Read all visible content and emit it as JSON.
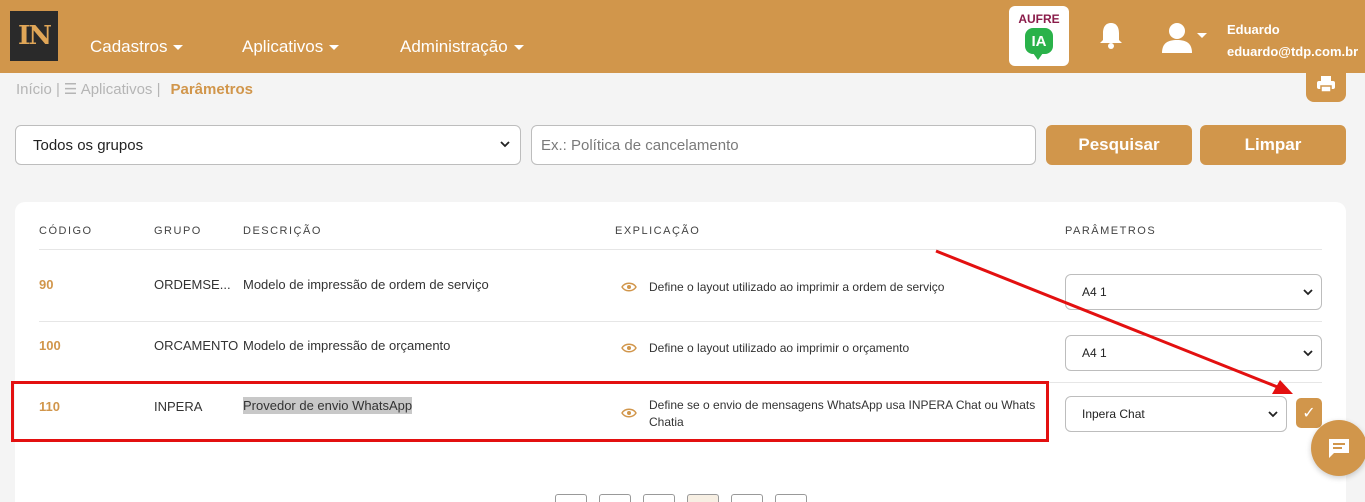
{
  "header": {
    "logo": "IN",
    "nav": [
      {
        "label": "Cadastros"
      },
      {
        "label": "Aplicativos"
      },
      {
        "label": "Administração"
      }
    ],
    "aufre_label": "AUFRE",
    "aufre_badge": "IA",
    "user_name": "Eduardo",
    "user_email": "eduardo@tdp.com.br"
  },
  "breadcrumb": {
    "home": "Início |",
    "apps": "☰ Aplicativos |",
    "current": "Parâmetros"
  },
  "filters": {
    "group_selected": "Todos os grupos",
    "search_placeholder": "Ex.: Política de cancelamento",
    "search_label": "Pesquisar",
    "clear_label": "Limpar"
  },
  "table": {
    "headers": {
      "code": "CÓDIGO",
      "group": "GRUPO",
      "description": "DESCRIÇÃO",
      "explanation": "EXPLICAÇÃO",
      "parameters": "PARÂMETROS"
    },
    "rows": [
      {
        "code": "90",
        "group": "ORDEMSE...",
        "description": "Modelo de impressão de ordem de serviço",
        "explanation": "Define o layout utilizado ao imprimir a ordem de serviço",
        "explanation2": "",
        "value": "A4 1"
      },
      {
        "code": "100",
        "group": "ORCAMENTO",
        "description": "Modelo de impressão de orçamento",
        "explanation": "Define o layout utilizado ao imprimir o orçamento",
        "explanation2": "",
        "value": "A4 1"
      },
      {
        "code": "110",
        "group": "INPERA",
        "description": "Provedor de envio WhatsApp",
        "explanation": "Define se o envio de mensagens WhatsApp usa INPERA Chat ou Whats",
        "explanation2": "Chatia",
        "value": "Inpera Chat"
      }
    ],
    "confirm_symbol": "✓"
  },
  "colors": {
    "brand": "#d1964b",
    "annotation": "#e31010"
  }
}
